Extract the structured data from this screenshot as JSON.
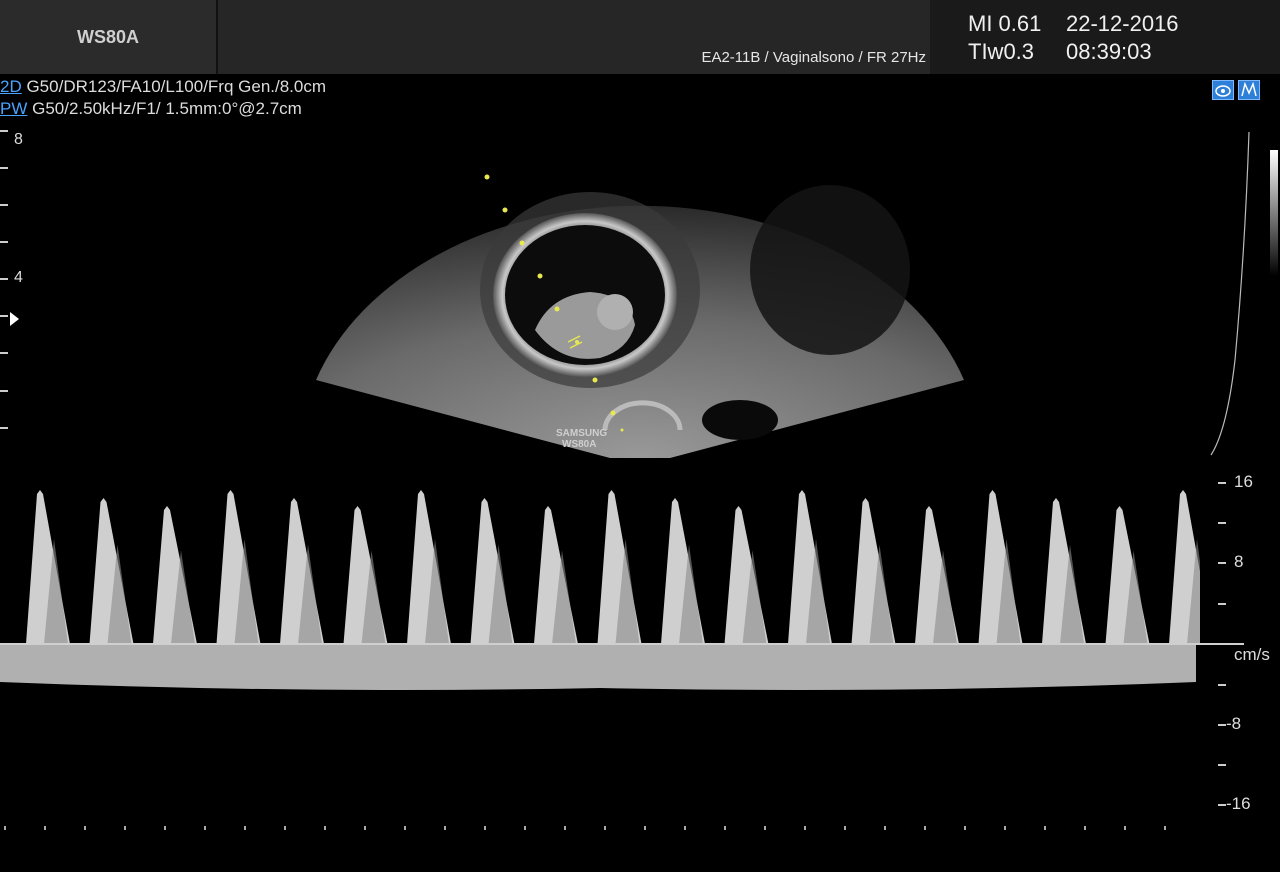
{
  "header": {
    "device": "WS80A",
    "probe_info": "EA2-11B / Vaginalsono / FR 27Hz",
    "mi": "MI  0.61",
    "tiw": "TIw0.3",
    "date": "22-12-2016",
    "time": "08:39:03"
  },
  "params": {
    "mode_2d": "2D",
    "line_2d": " G50/DR123/FA10/L100/Frq Gen./8.0cm",
    "mode_pw": "PW",
    "line_pw": " G50/2.50kHz/F1/ 1.5mm:0°@2.7cm"
  },
  "depth_scale": {
    "labels": [
      "8",
      "4"
    ]
  },
  "image_text": {
    "watermark_line1": "SAMSUNG",
    "watermark_line2": "WS80A"
  },
  "velocity_scale": {
    "labels": [
      "16",
      "8",
      "-8",
      "-16"
    ],
    "units": "cm/s"
  },
  "icons": {
    "left": "probe-view-icon",
    "right": "measure-mode-icon"
  }
}
